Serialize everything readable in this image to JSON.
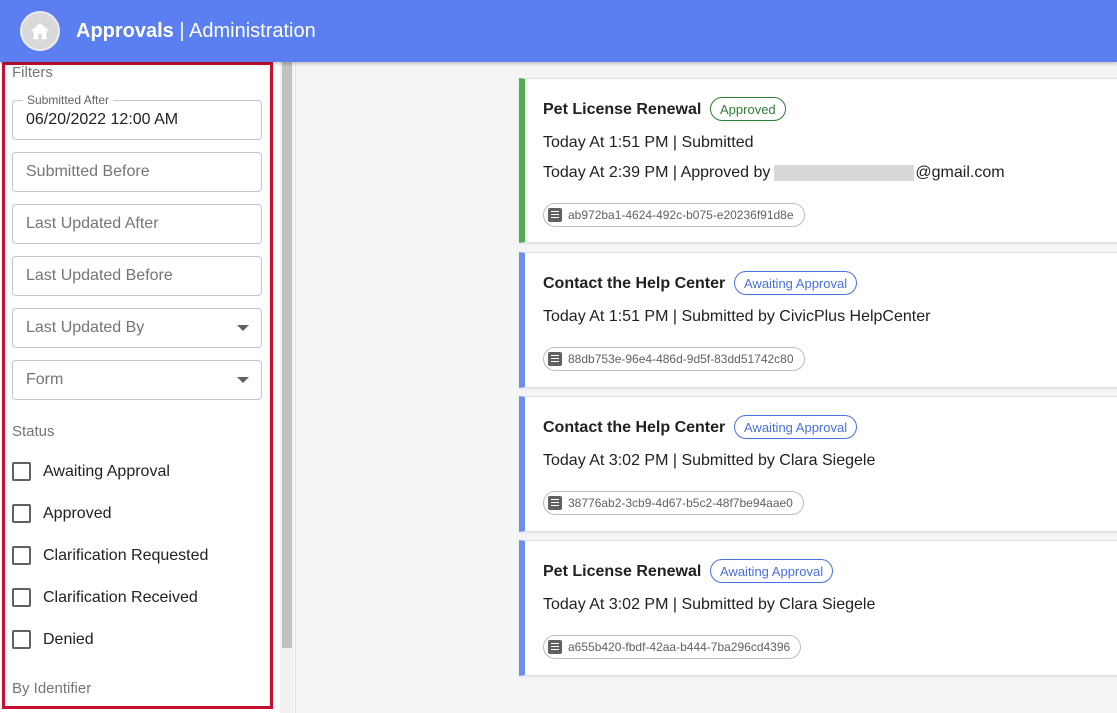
{
  "header": {
    "app_name": "Approvals",
    "separator": "|",
    "section": "Administration",
    "home_icon": "home-icon"
  },
  "filters": {
    "heading": "Filters",
    "submitted_after": {
      "label": "Submitted After",
      "value": "06/20/2022 12:00 AM"
    },
    "submitted_before": {
      "placeholder": "Submitted Before"
    },
    "last_updated_after": {
      "placeholder": "Last Updated After"
    },
    "last_updated_before": {
      "placeholder": "Last Updated Before"
    },
    "last_updated_by": {
      "placeholder": "Last Updated By"
    },
    "form": {
      "placeholder": "Form"
    },
    "status_heading": "Status",
    "statuses": [
      {
        "label": "Awaiting Approval",
        "checked": false
      },
      {
        "label": "Approved",
        "checked": false
      },
      {
        "label": "Clarification Requested",
        "checked": false
      },
      {
        "label": "Clarification Received",
        "checked": false
      },
      {
        "label": "Denied",
        "checked": false
      }
    ],
    "identifier_heading": "By Identifier"
  },
  "cards": [
    {
      "title": "Pet License Renewal",
      "status": "Approved",
      "status_color": "#2e7d32",
      "line1": "Today At 1:51 PM | Submitted",
      "line2_prefix": "Today At 2:39 PM | Approved by",
      "line2_suffix": "@gmail.com",
      "id": "ab972ba1-4624-492c-b075-e20236f91d8e"
    },
    {
      "title": "Contact the Help Center",
      "status": "Awaiting Approval",
      "status_color": "#4a6fe3",
      "line1": "Today At 1:51 PM | Submitted by CivicPlus HelpCenter",
      "id": "88db753e-96e4-486d-9d5f-83dd51742c80"
    },
    {
      "title": "Contact the Help Center",
      "status": "Awaiting Approval",
      "status_color": "#4a6fe3",
      "line1": "Today At 3:02 PM | Submitted by Clara Siegele",
      "id": "38776ab2-3cb9-4d67-b5c2-48f7be94aae0"
    },
    {
      "title": "Pet License Renewal",
      "status": "Awaiting Approval",
      "status_color": "#4a6fe3",
      "line1": "Today At 3:02 PM | Submitted by Clara Siegele",
      "id": "a655b420-fbdf-42aa-b444-7ba296cd4396"
    }
  ],
  "colors": {
    "header_bg": "#5b7ff0",
    "approved_accent": "#4caf50",
    "awaiting_accent": "#6c8ef0",
    "highlight_border": "#c5102f"
  }
}
